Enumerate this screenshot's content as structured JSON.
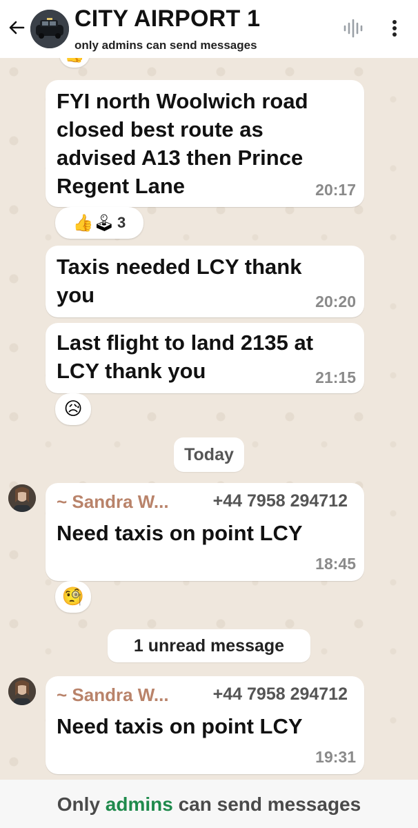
{
  "header": {
    "title": "CITY AIRPORT 1",
    "subtitle": "only admins can send messages",
    "back_icon": "arrow-left-icon",
    "voice_icon": "voice-waveform-icon",
    "menu_icon": "more-vertical-icon"
  },
  "messages": [
    {
      "text_lines": [
        "FYI north Woolwich road",
        "closed best route as",
        "advised A13 then Prince",
        "Regent Lane"
      ],
      "time": "20:17",
      "reaction": {
        "emojis": "👍🕹",
        "count": "3"
      }
    },
    {
      "text_lines": [
        "Taxis needed LCY thank",
        "you"
      ],
      "time": "20:20"
    },
    {
      "text_lines": [
        "Last flight to land 2135 at",
        "LCY thank you"
      ],
      "time": "21:15",
      "reaction": {
        "emojis": "😥"
      }
    }
  ],
  "date_separator": "Today",
  "group_messages": [
    {
      "sender": "~ Sandra W...",
      "phone": "+44 7958 294712",
      "text": "Need taxis on point LCY",
      "time": "18:45",
      "reaction": {
        "emojis": "🧐"
      }
    },
    {
      "sender": "~ Sandra W...",
      "phone": "+44 7958 294712",
      "text": "Need taxis on point LCY",
      "time": "19:31"
    }
  ],
  "unread_label": "1 unread message",
  "footer": {
    "prefix": "Only ",
    "accent": "admins",
    "suffix": " can send messages"
  },
  "colors": {
    "accent_green": "#1f8a4c",
    "sender_name": "#b9836a",
    "chat_bg": "#efe7dd"
  }
}
